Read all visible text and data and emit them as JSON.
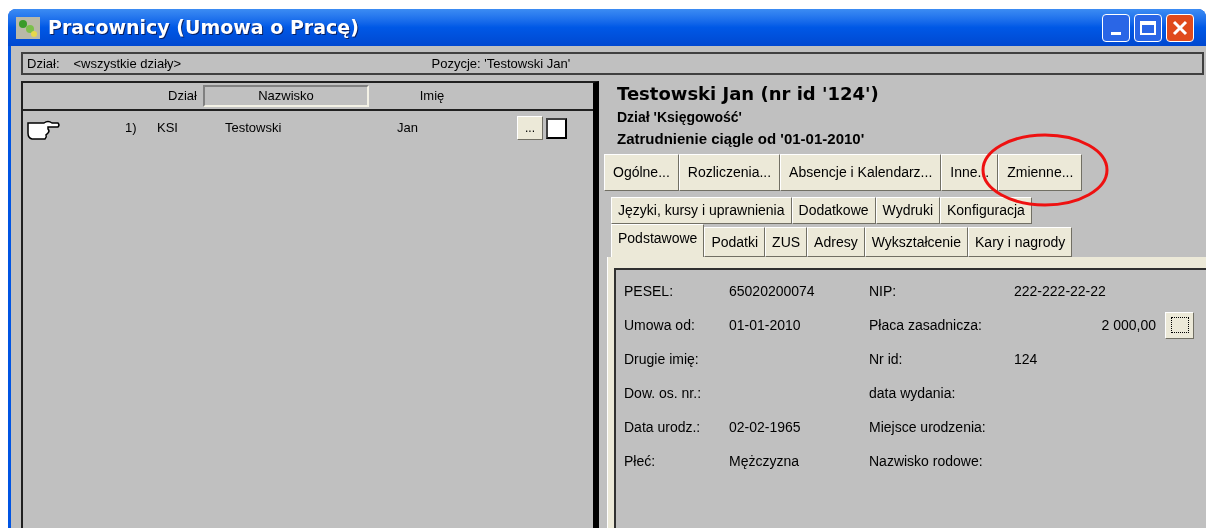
{
  "window": {
    "title": "Pracownicy (Umowa o Pracę)"
  },
  "filter_bar": {
    "label": "Dział:",
    "value": "<wszystkie działy>",
    "position": "Pozycje: 'Testowski Jan'"
  },
  "list": {
    "columns": [
      {
        "label": "Dział",
        "selected": false
      },
      {
        "label": "Nazwisko",
        "selected": true
      },
      {
        "label": "Imię",
        "selected": false
      }
    ],
    "rows": [
      {
        "number": "1)",
        "department": "KSI",
        "surname": "Testowski",
        "name": "Jan",
        "button": "...",
        "checked": false,
        "current": true
      }
    ]
  },
  "details": {
    "heading": "Testowski Jan (nr id '124')",
    "department": "Dział 'Księgowość'",
    "employment": "Zatrudnienie ciągle od '01-01-2010'",
    "buttons": [
      {
        "label": "Ogólne...",
        "highlighted": false
      },
      {
        "label": "Rozliczenia...",
        "highlighted": false
      },
      {
        "label": "Absencje i Kalendarz...",
        "highlighted": false
      },
      {
        "label": "Inne...",
        "highlighted": false
      },
      {
        "label": "Zmienne...",
        "highlighted": true
      }
    ],
    "tabs_back": [
      {
        "label": "Języki, kursy i uprawnienia",
        "selected": false
      },
      {
        "label": "Dodatkowe",
        "selected": false
      },
      {
        "label": "Wydruki",
        "selected": false
      },
      {
        "label": "Konfiguracja",
        "selected": false
      }
    ],
    "tabs_front": [
      {
        "label": "Podstawowe",
        "selected": true
      },
      {
        "label": "Podatki",
        "selected": false
      },
      {
        "label": "ZUS",
        "selected": false
      },
      {
        "label": "Adresy",
        "selected": false
      },
      {
        "label": "Wykształcenie",
        "selected": false
      },
      {
        "label": "Kary i nagrody",
        "selected": false
      }
    ],
    "fields": [
      {
        "label": "PESEL:",
        "value": "65020200074",
        "label2": "NIP:",
        "value2": "222-222-22-22"
      },
      {
        "label": "Umowa od:",
        "value": "01-01-2010",
        "label2": "Płaca zasadnicza:",
        "value2": "2 000,00",
        "has_button": true
      },
      {
        "label": "Drugie imię:",
        "label2": "Nr id:",
        "value2": "124"
      },
      {
        "label": "Dow. os. nr.:",
        "label2": "data wydania:"
      },
      {
        "label": "Data urodz.:",
        "value": "02-02-1965",
        "label2": "Miejsce urodzenia:"
      },
      {
        "label": "Płeć:",
        "value": "Mężczyzna",
        "label2": "Nazwisko rodowe:"
      }
    ]
  }
}
